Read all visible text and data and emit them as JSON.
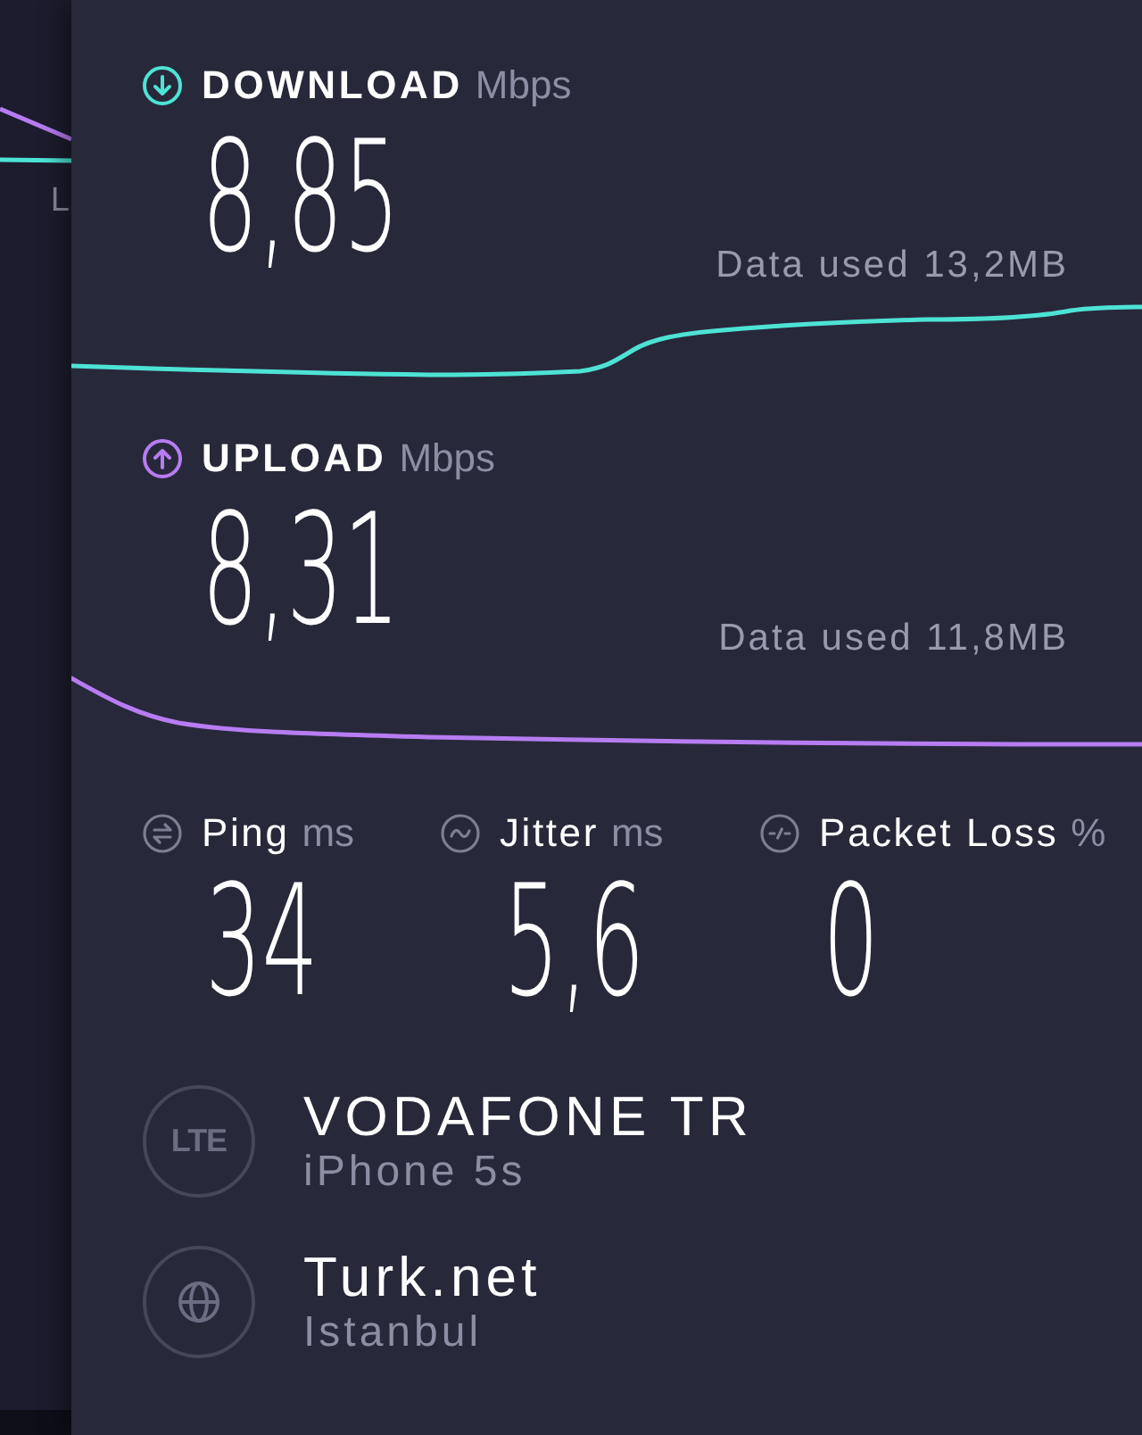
{
  "background_panel": {
    "label": "L"
  },
  "results": [
    {
      "kind": "download",
      "title": "DOWNLOAD",
      "unit": "Mbps",
      "value": "8,85",
      "data_used": "Data used 13,2MB",
      "color": "#4de3d4"
    },
    {
      "kind": "upload",
      "title": "UPLOAD",
      "unit": "Mbps",
      "value": "8,31",
      "data_used": "Data used 11,8MB",
      "color": "#b77cf2"
    }
  ],
  "metrics": [
    {
      "kind": "ping",
      "label": "Ping",
      "unit": "ms",
      "value": "34"
    },
    {
      "kind": "jitter",
      "label": "Jitter",
      "unit": "ms",
      "value": "5,6"
    },
    {
      "kind": "packet_loss",
      "label": "Packet Loss",
      "unit": "%",
      "value": "0"
    }
  ],
  "connections": [
    {
      "kind": "network",
      "badge": "LTE",
      "name": "VODAFONE TR",
      "detail": "iPhone 5s"
    },
    {
      "kind": "server",
      "name": "Turk.net",
      "detail": "Istanbul"
    }
  ]
}
